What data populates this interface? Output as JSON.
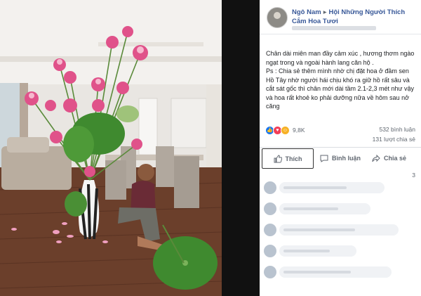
{
  "post": {
    "author": "Ngô Nam",
    "group": "Hội Những Người Thích Cắm Hoa Tươi",
    "body_lines": [
      "Chân dài miên man đầy cảm xúc , hương thơm ngào ngạt trong và ngoài hành lang căn hộ .",
      "Ps : Chia sẻ thêm mình nhờ chị đặt hoa ở đầm sen Hồ Tây nhờ người hái chịu khó ra giữ hồ rất sâu và cắt sát gốc thì chân mới dài tầm 2.1-2,3 mét như vậy và hoa rất khoẻ ko phải dưỡng nữa về hôm sau nở căng"
    ]
  },
  "stats": {
    "reactions": "9,8K",
    "comments": "532 bình luận",
    "shares": "131 lượt chia sẻ"
  },
  "actions": {
    "like": "Thích",
    "comment": "Bình luận",
    "share": "Chia sẻ"
  },
  "comments_partial": "3",
  "colors": {
    "link_blue": "#385898",
    "fb_blue": "#1877f2",
    "lotus_pink": "#e0528a",
    "leaf_green": "#3f8a2f"
  }
}
